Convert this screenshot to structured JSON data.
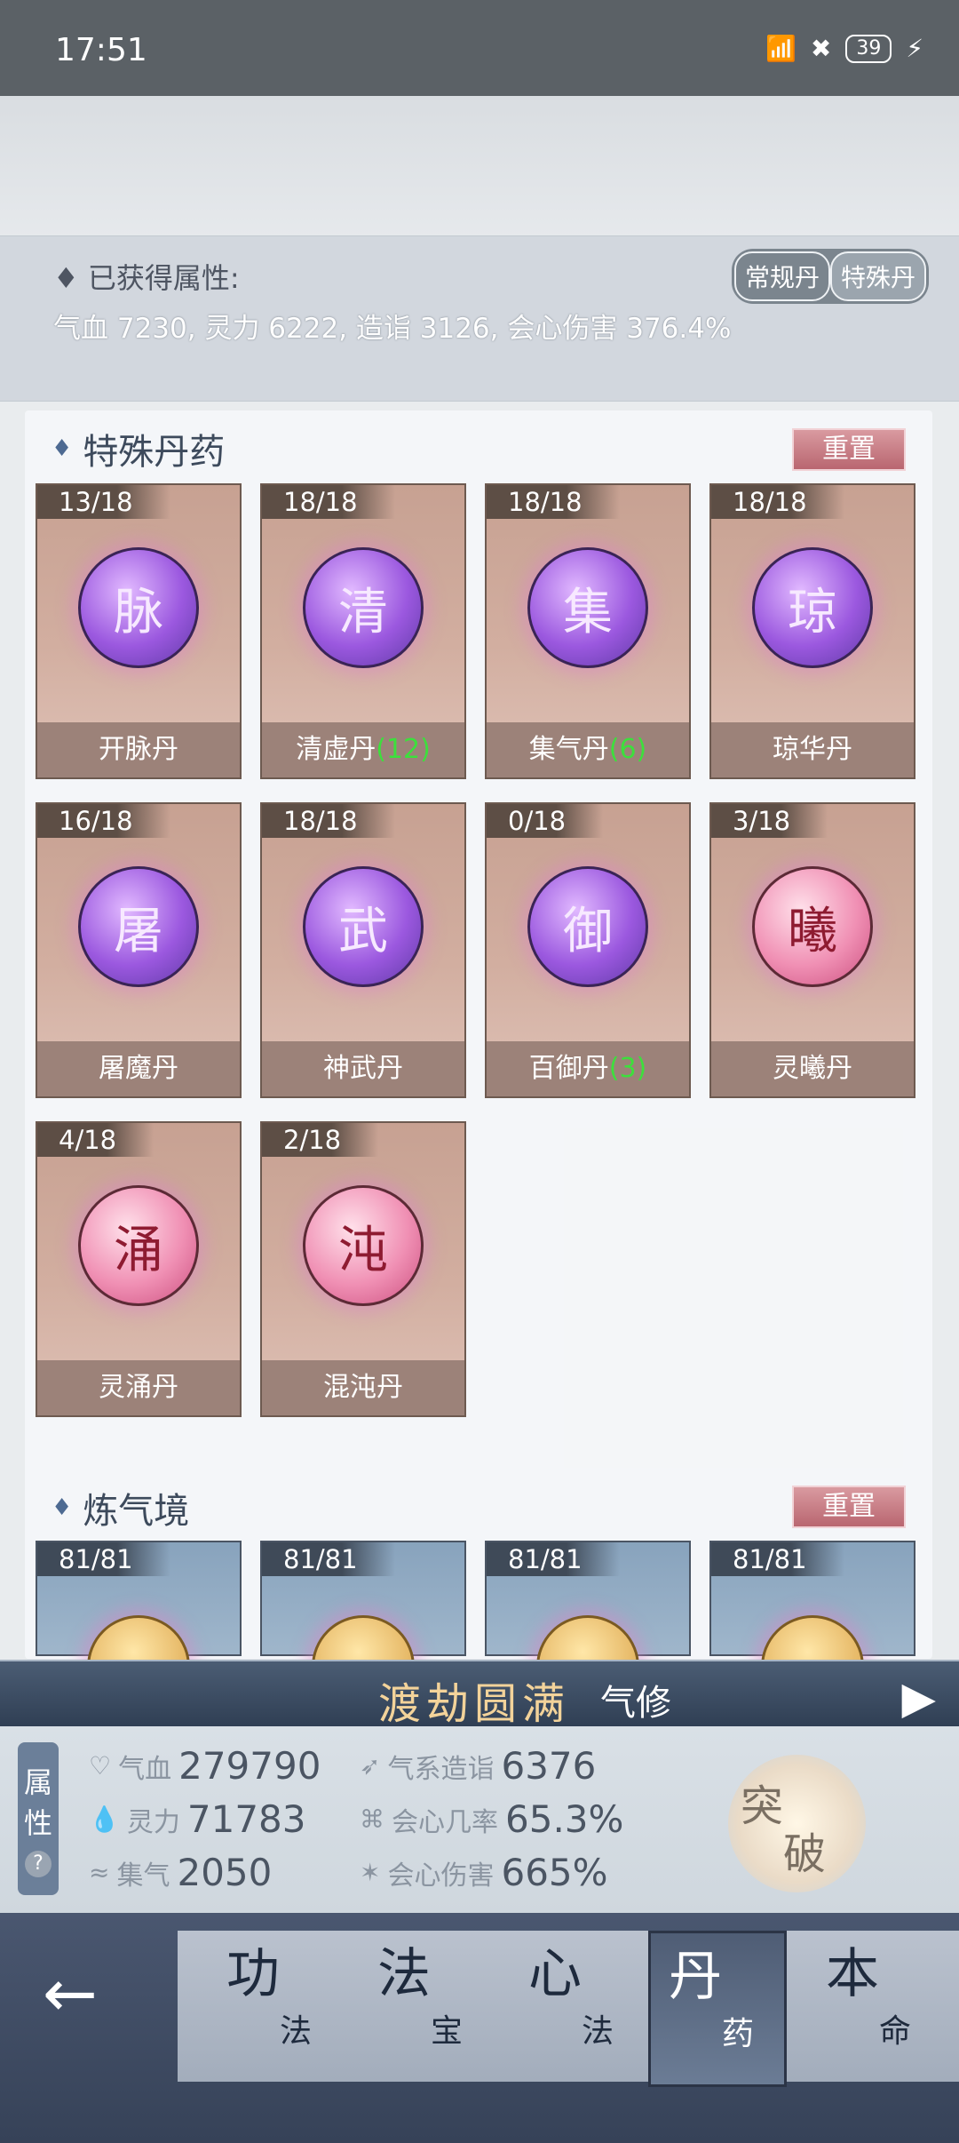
{
  "status_bar": {
    "time": "17:51",
    "battery": "39"
  },
  "attributes": {
    "title": "已获得属性:",
    "value": "气血 7230, 灵力 6222, 造诣 3126, 会心伤害 376.4%",
    "tabs": [
      "常规丹",
      "特殊丹"
    ]
  },
  "special_section": {
    "title": "特殊丹药",
    "reset_label": "重置",
    "pills": [
      {
        "count": "13/18",
        "glyph": "脉",
        "name": "开脉丹",
        "extra": "",
        "style": "purple"
      },
      {
        "count": "18/18",
        "glyph": "清",
        "name": "清虚丹",
        "extra": "(12)",
        "style": "purple"
      },
      {
        "count": "18/18",
        "glyph": "集",
        "name": "集气丹",
        "extra": "(6)",
        "style": "purple"
      },
      {
        "count": "18/18",
        "glyph": "琼",
        "name": "琼华丹",
        "extra": "",
        "style": "purple"
      },
      {
        "count": "16/18",
        "glyph": "屠",
        "name": "屠魔丹",
        "extra": "",
        "style": "purple"
      },
      {
        "count": "18/18",
        "glyph": "武",
        "name": "神武丹",
        "extra": "",
        "style": "purple"
      },
      {
        "count": "0/18",
        "glyph": "御",
        "name": "百御丹",
        "extra": "(3)",
        "style": "purple"
      },
      {
        "count": "3/18",
        "glyph": "曦",
        "name": "灵曦丹",
        "extra": "",
        "style": "pink"
      },
      {
        "count": "4/18",
        "glyph": "涌",
        "name": "灵涌丹",
        "extra": "",
        "style": "pink"
      },
      {
        "count": "2/18",
        "glyph": "沌",
        "name": "混沌丹",
        "extra": "",
        "style": "pink"
      }
    ]
  },
  "qi_section": {
    "title": "炼气境",
    "reset_label": "重置",
    "pills": [
      {
        "count": "81/81"
      },
      {
        "count": "81/81"
      },
      {
        "count": "81/81"
      },
      {
        "count": "81/81"
      }
    ]
  },
  "banner": {
    "realm": "渡劫圆满",
    "type": "气修"
  },
  "stats": {
    "label_top": "属",
    "label_bottom": "性",
    "help": "?",
    "items": [
      {
        "label": "气血",
        "value": "279790"
      },
      {
        "label": "灵力",
        "value": "71783"
      },
      {
        "label": "集气",
        "value": "2050"
      },
      {
        "label": "气系造诣",
        "value": "6376"
      },
      {
        "label": "会心几率",
        "value": "65.3%"
      },
      {
        "label": "会心伤害",
        "value": "665%"
      }
    ],
    "breakthrough": {
      "top": "突",
      "bottom": "破"
    }
  },
  "nav": [
    {
      "big": "功",
      "small": "法"
    },
    {
      "big": "法",
      "small": "宝"
    },
    {
      "big": "心",
      "small": "法"
    },
    {
      "big": "丹",
      "small": "药"
    },
    {
      "big": "本",
      "small": "命"
    }
  ]
}
